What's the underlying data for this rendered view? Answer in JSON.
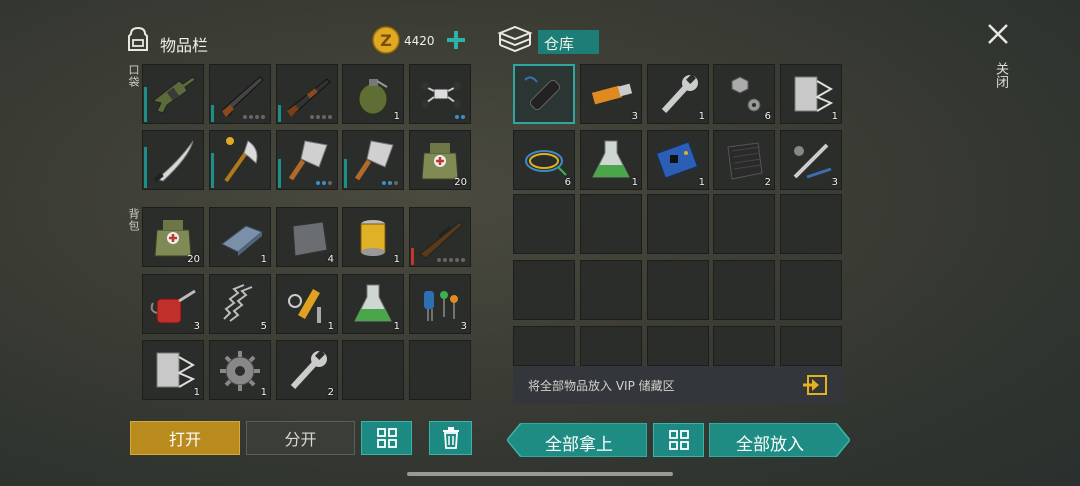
{
  "inventory": {
    "title": "物品栏",
    "coins": "4420",
    "pocket_label": "口袋",
    "backpack_label": "背包",
    "pocket": [
      {
        "icon": "assault-rifle-icon",
        "count": "",
        "dur": 0.6,
        "dots": 0
      },
      {
        "icon": "shotgun-icon",
        "count": "",
        "dur": 0.3,
        "dots": 4
      },
      {
        "icon": "pump-shotgun-icon",
        "count": "",
        "dur": 0.3,
        "dots": 4
      },
      {
        "icon": "grenade-icon",
        "count": "1",
        "dur": 0,
        "dots": 0
      },
      {
        "icon": "drone-icon",
        "count": "",
        "dur": 0,
        "dots": 2
      },
      {
        "icon": "machete-icon",
        "count": "",
        "dur": 0.7,
        "dots": 0
      },
      {
        "icon": "ornate-axe-icon",
        "count": "",
        "dur": 0.6,
        "dots": 0
      },
      {
        "icon": "cleaver-icon",
        "count": "",
        "dur": 0.5,
        "dots": 3
      },
      {
        "icon": "cleaver-icon",
        "count": "",
        "dur": 0.5,
        "dots": 3
      },
      {
        "icon": "medkit-bag-icon",
        "count": "20",
        "dur": 0,
        "dots": 0
      }
    ],
    "backpack": [
      {
        "icon": "medkit-bag-icon",
        "count": "20"
      },
      {
        "icon": "steel-ingot-icon",
        "count": "1"
      },
      {
        "icon": "metal-plate-icon",
        "count": "4"
      },
      {
        "icon": "oil-filter-icon",
        "count": "1"
      },
      {
        "icon": "sniper-rifle-icon",
        "count": "",
        "dur": 0.3,
        "red": true,
        "dots": 5
      },
      {
        "icon": "oil-can-icon",
        "count": "3"
      },
      {
        "icon": "spring-icon",
        "count": "5"
      },
      {
        "icon": "hydraulic-parts-icon",
        "count": "1"
      },
      {
        "icon": "chemical-flask-icon",
        "count": "1"
      },
      {
        "icon": "electronic-parts-icon",
        "count": "3"
      },
      {
        "icon": "duct-tape-icon",
        "count": "1"
      },
      {
        "icon": "gear-icon",
        "count": "1"
      },
      {
        "icon": "wrench-icon",
        "count": "2"
      },
      {
        "icon": "",
        "count": ""
      },
      {
        "icon": "",
        "count": ""
      }
    ]
  },
  "storage": {
    "title": "仓库",
    "items": [
      {
        "icon": "silencer-icon",
        "count": "",
        "selected": true
      },
      {
        "icon": "usb-drive-icon",
        "count": "3"
      },
      {
        "icon": "wrench-icon",
        "count": "1"
      },
      {
        "icon": "bolts-icon",
        "count": "6"
      },
      {
        "icon": "duct-tape-icon",
        "count": "1"
      },
      {
        "icon": "wires-icon",
        "count": "6"
      },
      {
        "icon": "chemical-flask-icon",
        "count": "1"
      },
      {
        "icon": "circuit-board-icon",
        "count": "1"
      },
      {
        "icon": "rubber-sheet-icon",
        "count": "2"
      },
      {
        "icon": "tools-icon",
        "count": "3"
      }
    ],
    "vip_text": "将全部物品放入 VIP 储藏区"
  },
  "buttons": {
    "open": "打开",
    "split": "分开",
    "take_all": "全部拿上",
    "put_all": "全部放入"
  },
  "close_label": "关闭"
}
